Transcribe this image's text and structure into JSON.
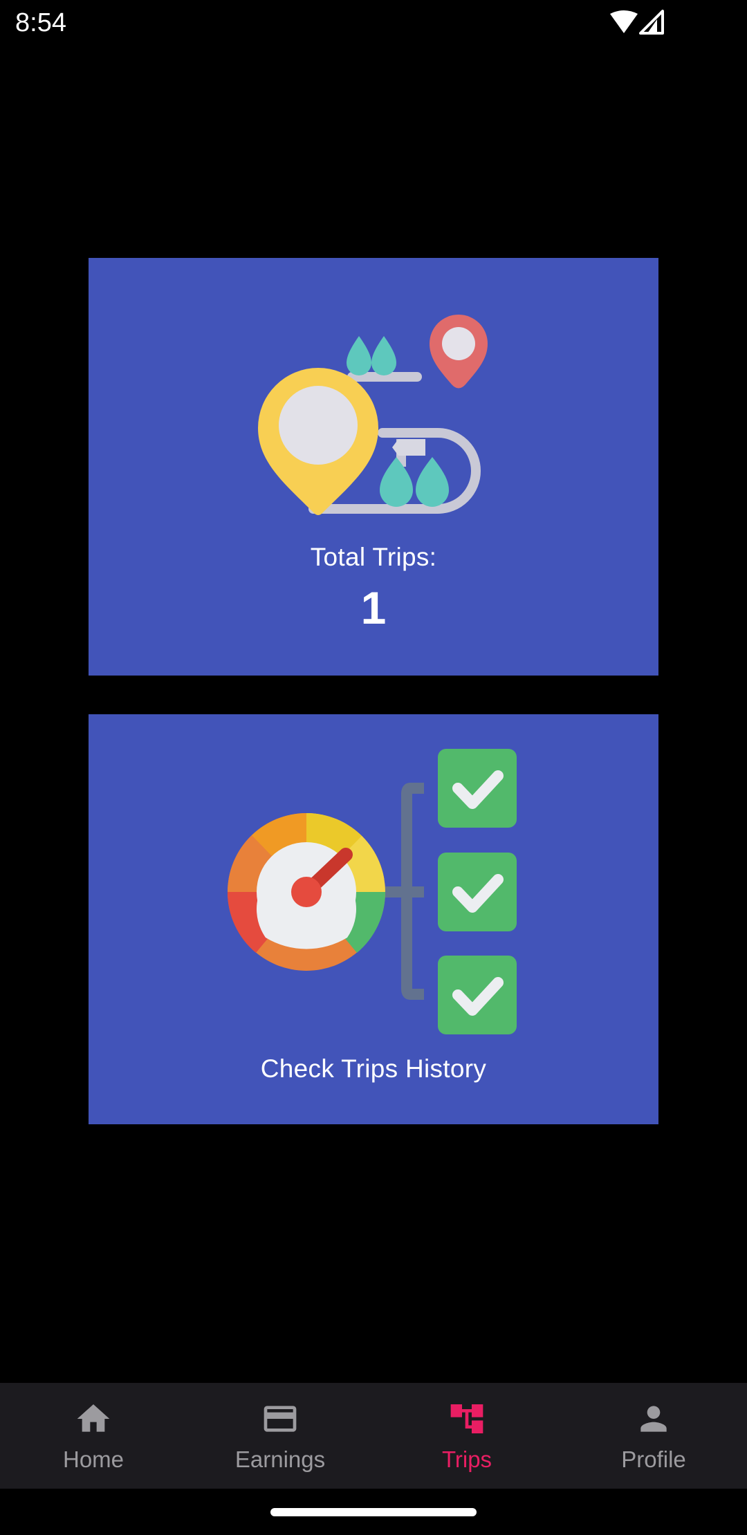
{
  "status_bar": {
    "time": "8:54"
  },
  "cards": {
    "total_trips": {
      "label": "Total Trips:",
      "count": "1",
      "icon": "map-route-icon"
    },
    "trips_history": {
      "label": "Check Trips History",
      "icon": "speedometer-checklist-icon"
    }
  },
  "bottom_nav": {
    "items": [
      {
        "label": "Home",
        "icon": "home-icon",
        "active": false
      },
      {
        "label": "Earnings",
        "icon": "credit-card-icon",
        "active": false
      },
      {
        "label": "Trips",
        "icon": "trips-flow-icon",
        "active": true
      },
      {
        "label": "Profile",
        "icon": "person-icon",
        "active": false
      }
    ]
  },
  "colors": {
    "background": "#000000",
    "card": "#4254b9",
    "nav_background": "#1c1b1f",
    "nav_inactive": "#9c9b9f",
    "nav_active": "#e91e63"
  }
}
